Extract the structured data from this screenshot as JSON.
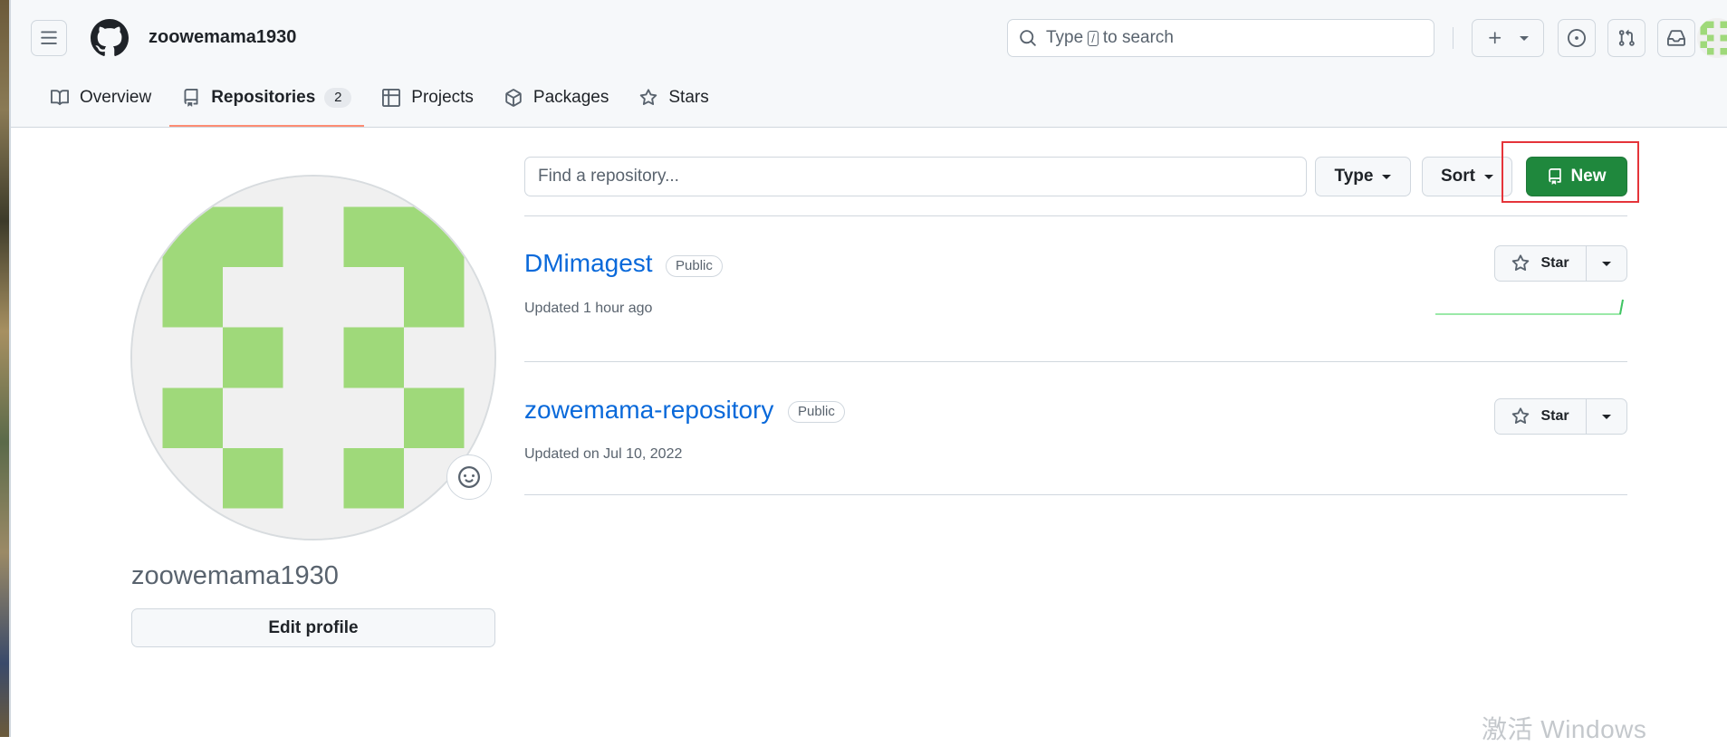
{
  "header": {
    "username": "zoowemama1930",
    "search_label_pre": "Type",
    "search_kbd": "/",
    "search_label_post": "to search"
  },
  "nav": {
    "tabs": [
      {
        "label": "Overview",
        "icon": "book-icon"
      },
      {
        "label": "Repositories",
        "icon": "repo-icon",
        "count": "2",
        "selected": true
      },
      {
        "label": "Projects",
        "icon": "table-icon"
      },
      {
        "label": "Packages",
        "icon": "package-icon"
      },
      {
        "label": "Stars",
        "icon": "star-icon"
      }
    ]
  },
  "profile": {
    "name": "zoowemama1930",
    "edit_label": "Edit profile"
  },
  "repo_toolbar": {
    "search_placeholder": "Find a repository...",
    "type_label": "Type",
    "sort_label": "Sort",
    "new_label": "New"
  },
  "repos": [
    {
      "name": "DMimagest",
      "visibility": "Public",
      "updated": "Updated 1 hour ago",
      "star_label": "Star"
    },
    {
      "name": "zowemama-repository",
      "visibility": "Public",
      "updated": "Updated on Jul 10, 2022",
      "star_label": "Star"
    }
  ],
  "watermark": "激活 Windows",
  "colors": {
    "accent_blue": "#0969da",
    "new_button_green": "#1f883d",
    "tab_underline": "#fd8c73",
    "highlight_red": "#e5343a",
    "identicon_green": "#9fd97a"
  }
}
